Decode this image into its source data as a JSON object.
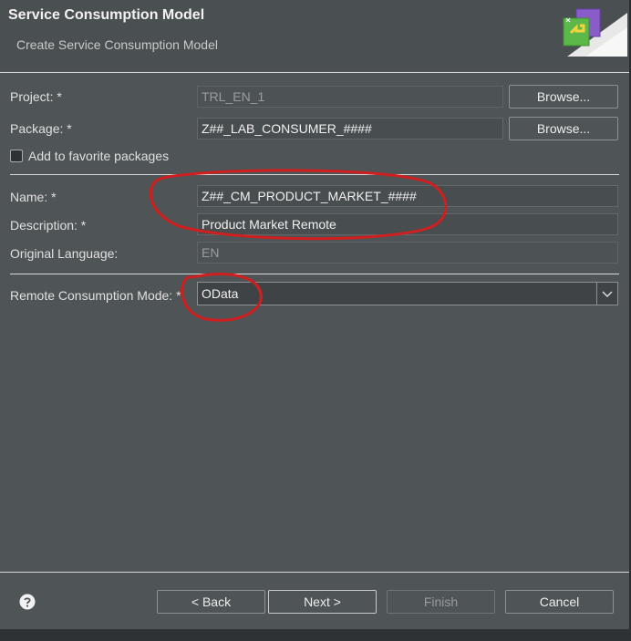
{
  "header": {
    "title": "Service Consumption Model",
    "subtitle": "Create Service Consumption Model"
  },
  "form": {
    "project": {
      "label": "Project: *",
      "value": "TRL_EN_1",
      "browse_label": "Browse..."
    },
    "package": {
      "label": "Package: *",
      "value": "Z##_LAB_CONSUMER_####",
      "browse_label": "Browse..."
    },
    "favorite": {
      "label": "Add to favorite packages",
      "checked": false
    },
    "name": {
      "label": "Name: *",
      "value": "Z##_CM_PRODUCT_MARKET_####"
    },
    "description": {
      "label": "Description: *",
      "value": "Product Market Remote"
    },
    "original_language": {
      "label": "Original Language:",
      "value": "EN"
    },
    "remote_mode": {
      "label": "Remote Consumption Mode: *",
      "value": "OData"
    }
  },
  "footer": {
    "help_icon": "help-icon",
    "back_label": "< Back",
    "next_label": "Next >",
    "finish_label": "Finish",
    "cancel_label": "Cancel"
  },
  "colors": {
    "annotation_red": "#d01f1f",
    "background": "#4f5457",
    "separator": "#d8d8d8"
  }
}
